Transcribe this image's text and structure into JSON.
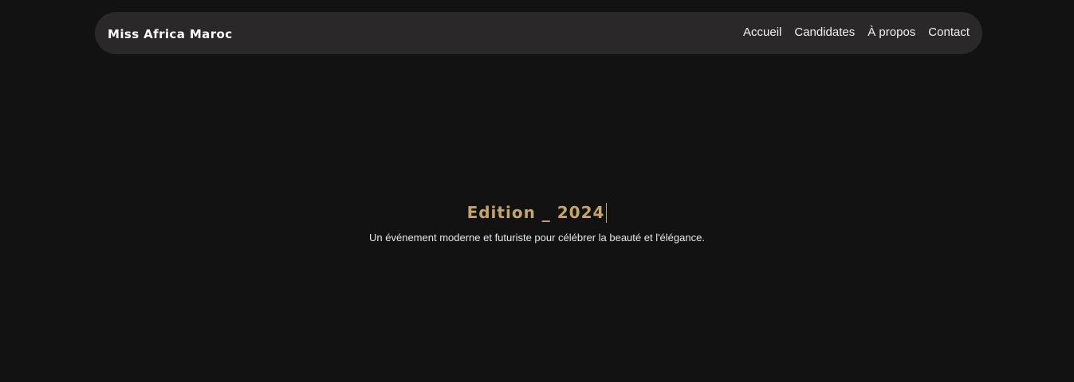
{
  "navbar": {
    "brand": "Miss Africa Maroc",
    "links": [
      {
        "label": "Accueil"
      },
      {
        "label": "Candidates"
      },
      {
        "label": "À propos"
      },
      {
        "label": "Contact"
      }
    ]
  },
  "hero": {
    "title": "Edition _ 2024",
    "subtitle": "Un événement moderne et futuriste pour célébrer la beauté et l'élégance."
  },
  "colors": {
    "background": "#121212",
    "navbar_bg": "#2a2828",
    "accent_gold": "#c7a56a",
    "text": "#ffffff"
  }
}
